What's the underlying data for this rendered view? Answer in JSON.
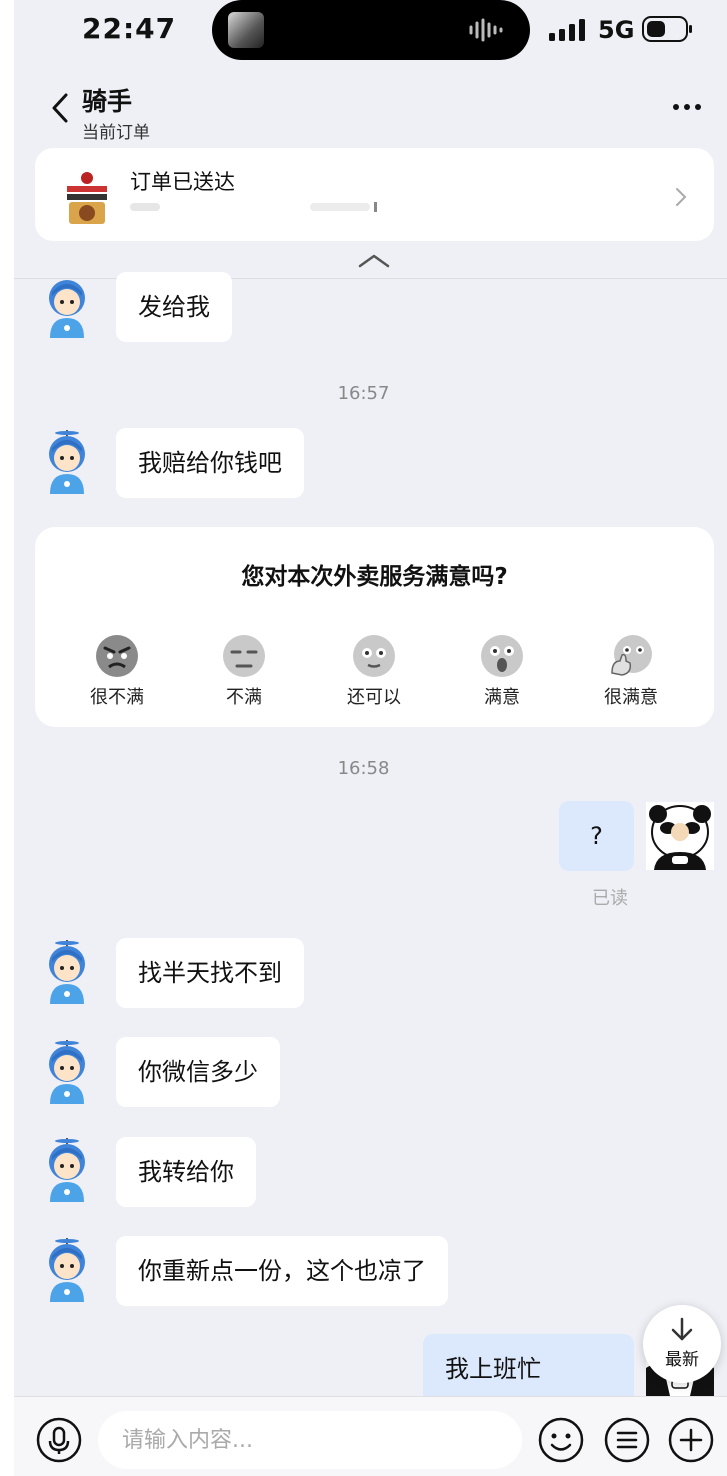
{
  "status_bar": {
    "time": "22:47",
    "network": "5G"
  },
  "nav": {
    "title": "骑手",
    "subtitle": "当前订单"
  },
  "order": {
    "status": "订单已送达"
  },
  "timestamps": [
    "16:57",
    "16:58"
  ],
  "messages": [
    {
      "from": "rider",
      "text": "发给我"
    },
    {
      "from": "rider",
      "text": "我赔给你钱吧"
    },
    {
      "from": "me",
      "text": "?"
    },
    {
      "from": "rider",
      "text": "找半天找不到"
    },
    {
      "from": "rider",
      "text": "你微信多少"
    },
    {
      "from": "rider",
      "text": "我转给你"
    },
    {
      "from": "rider",
      "text": "你重新点一份，这个也凉了"
    },
    {
      "from": "me",
      "text": "我上班忙"
    }
  ],
  "read_receipt": "已读",
  "survey": {
    "question": "您对本次外卖服务满意吗?",
    "options": [
      "很不满",
      "不满",
      "还可以",
      "满意",
      "很满意"
    ]
  },
  "scroll_latest": "最新",
  "input": {
    "placeholder": "请输入内容..."
  }
}
